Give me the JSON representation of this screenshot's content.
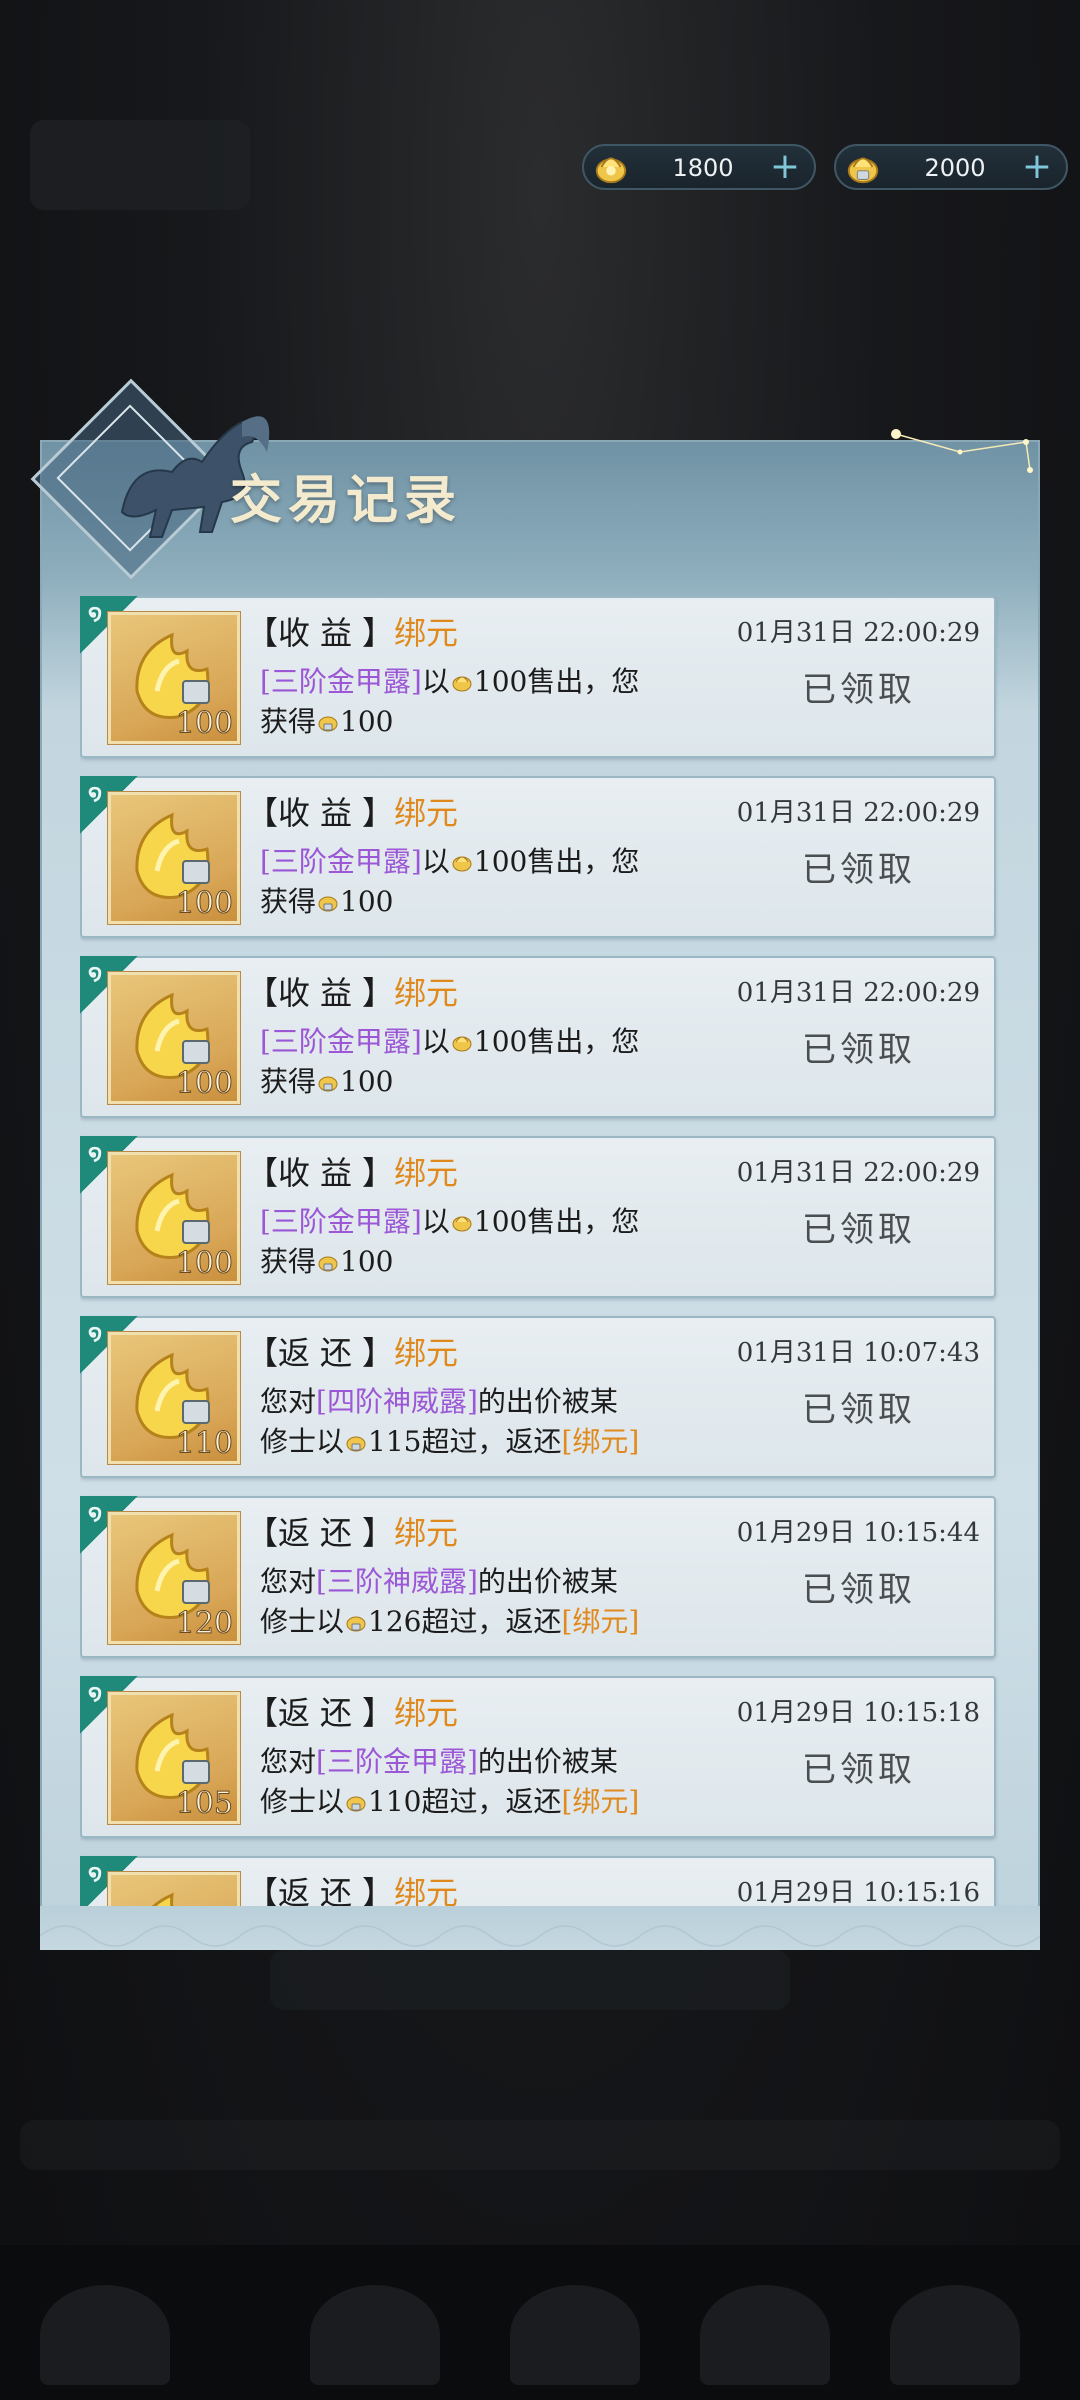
{
  "currency": [
    {
      "value": "1800",
      "icon": "gold-coin-icon"
    },
    {
      "value": "2000",
      "icon": "bound-coin-icon"
    }
  ],
  "panel": {
    "title": "交易记录"
  },
  "records": [
    {
      "tag": "收益",
      "currency": "绑元",
      "time": "01月31日 22:00:29",
      "qty": "100",
      "pre1": "",
      "item": "[三阶金甲露]",
      "mid1": "以",
      "amt1": "100",
      "post1": "售出，您",
      "pre2": "获得",
      "amt2": "100",
      "post2": "",
      "bind2": "",
      "status": "已领取"
    },
    {
      "tag": "收益",
      "currency": "绑元",
      "time": "01月31日 22:00:29",
      "qty": "100",
      "pre1": "",
      "item": "[三阶金甲露]",
      "mid1": "以",
      "amt1": "100",
      "post1": "售出，您",
      "pre2": "获得",
      "amt2": "100",
      "post2": "",
      "bind2": "",
      "status": "已领取"
    },
    {
      "tag": "收益",
      "currency": "绑元",
      "time": "01月31日 22:00:29",
      "qty": "100",
      "pre1": "",
      "item": "[三阶金甲露]",
      "mid1": "以",
      "amt1": "100",
      "post1": "售出，您",
      "pre2": "获得",
      "amt2": "100",
      "post2": "",
      "bind2": "",
      "status": "已领取"
    },
    {
      "tag": "收益",
      "currency": "绑元",
      "time": "01月31日 22:00:29",
      "qty": "100",
      "pre1": "",
      "item": "[三阶金甲露]",
      "mid1": "以",
      "amt1": "100",
      "post1": "售出，您",
      "pre2": "获得",
      "amt2": "100",
      "post2": "",
      "bind2": "",
      "status": "已领取"
    },
    {
      "tag": "返还",
      "currency": "绑元",
      "time": "01月31日 10:07:43",
      "qty": "110",
      "pre1": "您对",
      "item": "[四阶神威露]",
      "mid1": "的出价被某",
      "amt1": "",
      "post1": "",
      "pre2": "修士以",
      "amt2": "115",
      "post2": "超过，返还",
      "bind2": "[绑元]",
      "status": "已领取"
    },
    {
      "tag": "返还",
      "currency": "绑元",
      "time": "01月29日 10:15:44",
      "qty": "120",
      "pre1": "您对",
      "item": "[三阶神威露]",
      "mid1": "的出价被某",
      "amt1": "",
      "post1": "",
      "pre2": "修士以",
      "amt2": "126",
      "post2": "超过，返还",
      "bind2": "[绑元]",
      "status": "已领取"
    },
    {
      "tag": "返还",
      "currency": "绑元",
      "time": "01月29日 10:15:18",
      "qty": "105",
      "pre1": "您对",
      "item": "[三阶金甲露]",
      "mid1": "的出价被某",
      "amt1": "",
      "post1": "",
      "pre2": "修士以",
      "amt2": "110",
      "post2": "超过，返还",
      "bind2": "[绑元]",
      "status": "已领取"
    },
    {
      "tag": "返还",
      "currency": "绑元",
      "time": "01月29日 10:15:16",
      "qty": "",
      "pre1": "",
      "item": "",
      "mid1": "",
      "amt1": "",
      "post1": "",
      "pre2": "",
      "amt2": "",
      "post2": "",
      "bind2": "",
      "status": ""
    }
  ]
}
